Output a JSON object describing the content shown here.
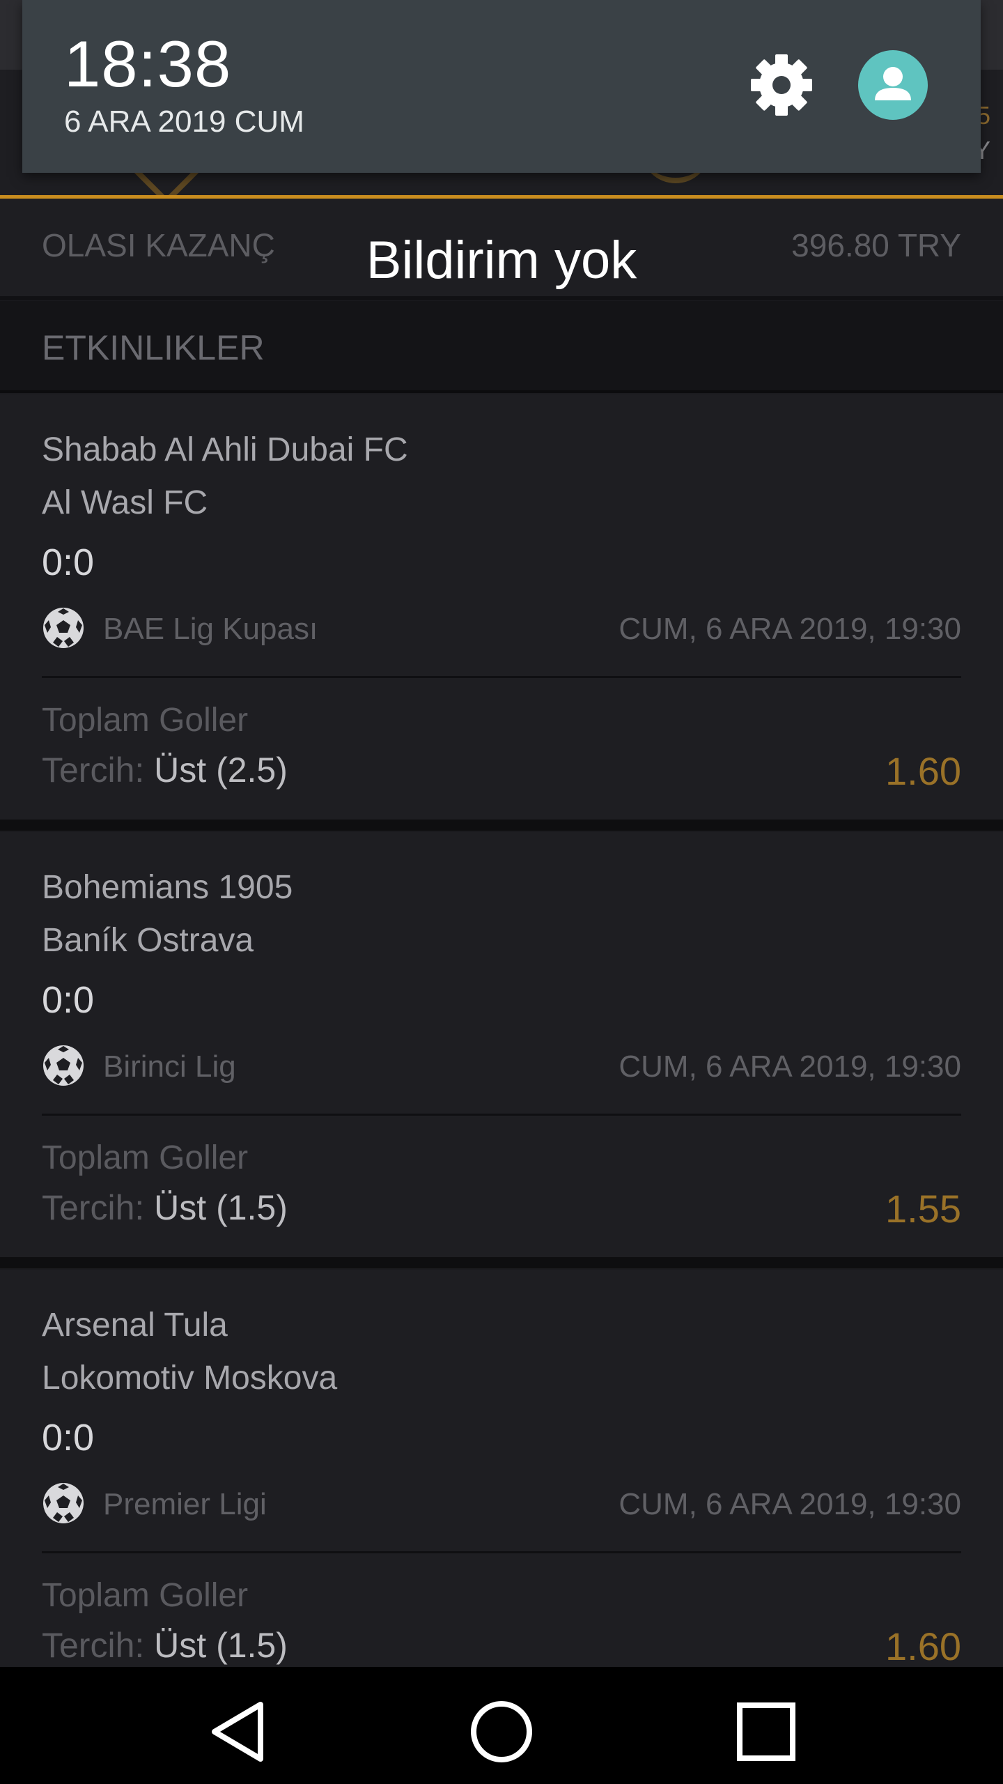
{
  "shade": {
    "time": "18:38",
    "date": "6 ARA 2019 CUM",
    "empty_message": "Bildirim yok",
    "icons": [
      "gear-icon",
      "user-avatar-icon"
    ]
  },
  "peek": {
    "value_top": "5",
    "value_sub": "Y"
  },
  "potential": {
    "label": "OLASI KAZANÇ",
    "value": "396.80 TRY"
  },
  "section": {
    "title": "ETKINLIKLER"
  },
  "events": [
    {
      "home": "Shabab Al Ahli Dubai FC",
      "away": "Al Wasl FC",
      "score": "0:0",
      "league": "BAE Lig Kupası",
      "datetime": "CUM, 6 ARA 2019, 19:30",
      "market": "Toplam Goller",
      "pick_label": "Tercih: ",
      "pick_value": "Üst (2.5)",
      "odds": "1.60"
    },
    {
      "home": "Bohemians 1905",
      "away": "Baník Ostrava",
      "score": "0:0",
      "league": "Birinci Lig",
      "datetime": "CUM, 6 ARA 2019, 19:30",
      "market": "Toplam Goller",
      "pick_label": "Tercih: ",
      "pick_value": "Üst (1.5)",
      "odds": "1.55"
    },
    {
      "home": "Arsenal Tula",
      "away": "Lokomotiv Moskova",
      "score": "0:0",
      "league": "Premier Ligi",
      "datetime": "CUM, 6 ARA 2019, 19:30",
      "market": "Toplam Goller",
      "pick_label": "Tercih: ",
      "pick_value": "Üst (1.5)",
      "odds": "1.60"
    }
  ],
  "navbar": {
    "buttons": [
      "back-icon",
      "home-icon",
      "recents-icon"
    ]
  },
  "colors": {
    "accent": "#c98d1f",
    "odds": "#9a7228",
    "avatar": "#5fc4c0",
    "shade": "#3a4146"
  }
}
